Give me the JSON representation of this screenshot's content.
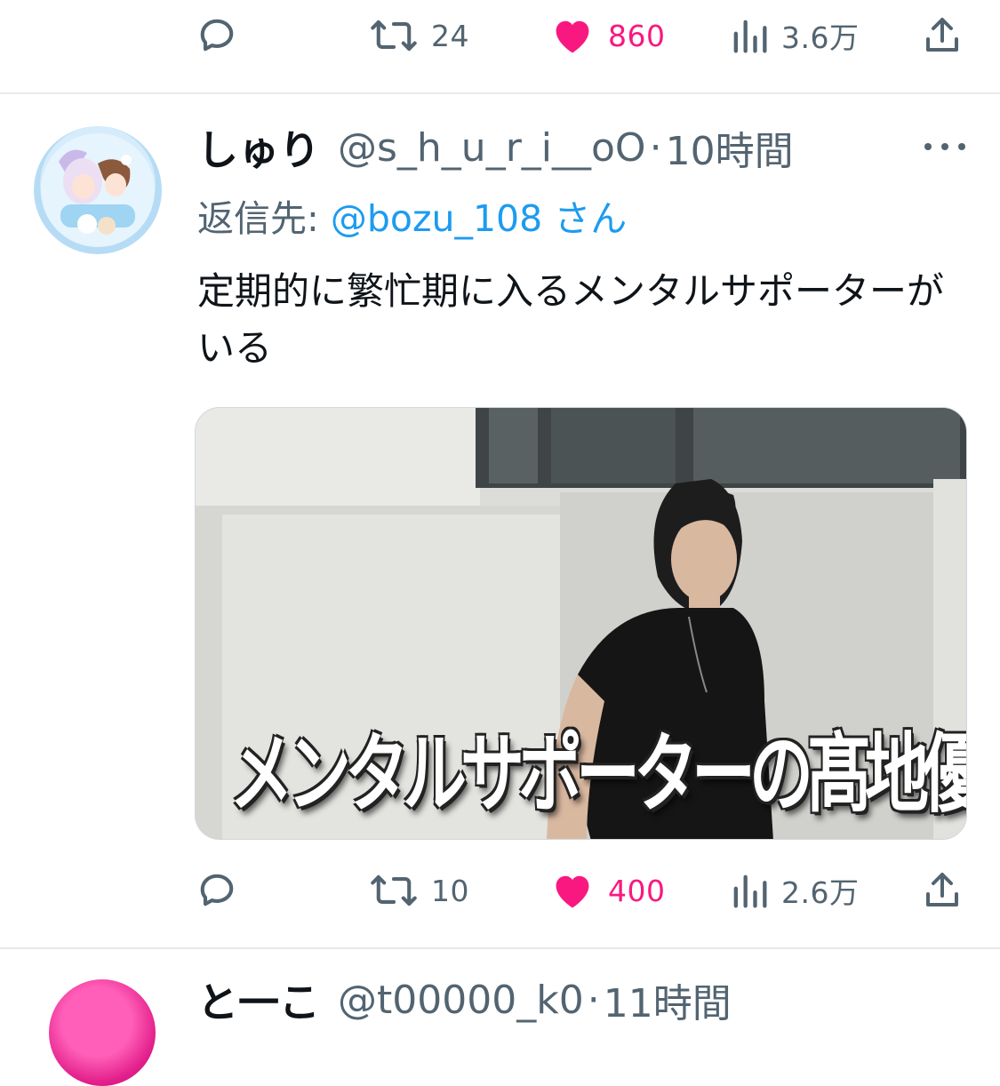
{
  "top_actions": {
    "reply_count": "",
    "retweet_count": "24",
    "like_count": "860",
    "views_count": "3.6万"
  },
  "tweet": {
    "display_name": "しゅり",
    "handle": "@s_h_u_r_i__oO",
    "separator": "·",
    "time": "10時間",
    "reply_prefix": "返信先: ",
    "reply_mention": "@bozu_108",
    "reply_suffix": "さん",
    "text": "定期的に繁忙期に入るメンタルサポーターがいる",
    "media_caption": "メンタルサポーターの髙地優吾です!",
    "actions": {
      "reply_count": "",
      "retweet_count": "10",
      "like_count": "400",
      "views_count": "2.6万"
    }
  },
  "next_tweet": {
    "display_name": "と一こ",
    "handle": "@t00000_k0",
    "separator": "·",
    "time": "11時間"
  },
  "colors": {
    "like": "#f91880",
    "mention": "#1d9bf0",
    "secondary_text": "#536471",
    "divider": "#e7e9ea"
  }
}
